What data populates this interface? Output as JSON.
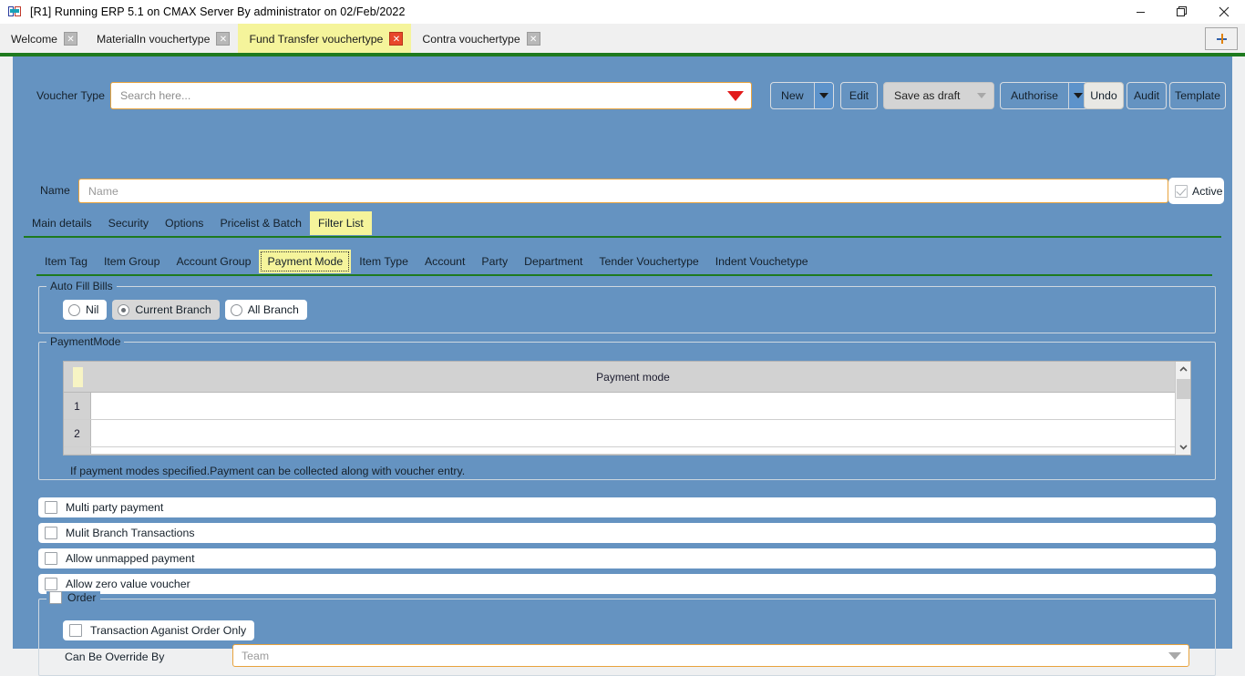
{
  "window": {
    "title": "[R1] Running ERP 5.1 on CMAX Server By administrator on 02/Feb/2022",
    "app_icon": "erp-app-icon",
    "minimize_icon": "minimize-icon",
    "restore_icon": "restore-icon",
    "close_icon": "close-icon"
  },
  "tabstrip": {
    "tabs": [
      {
        "label": "Welcome",
        "active": false
      },
      {
        "label": "MaterialIn vouchertype",
        "active": false
      },
      {
        "label": "Fund Transfer vouchertype",
        "active": true
      },
      {
        "label": "Contra vouchertype",
        "active": false
      }
    ],
    "new_tab_label": "+"
  },
  "form": {
    "voucher_type_label": "Voucher Type",
    "voucher_type_value": "",
    "voucher_type_placeholder": "Search here...",
    "name_label": "Name",
    "name_value": "",
    "name_placeholder": "Name",
    "active_label": "Active",
    "active_checked": true
  },
  "toolbar": {
    "new_label": "New",
    "edit_label": "Edit",
    "save_as_draft_label": "Save as draft",
    "authorise_label": "Authorise",
    "undo_label": "Undo",
    "audit_label": "Audit",
    "template_label": "Template"
  },
  "primary_tabs": [
    {
      "label": "Main details",
      "selected": false
    },
    {
      "label": "Security",
      "selected": false
    },
    {
      "label": "Options",
      "selected": false
    },
    {
      "label": "Pricelist & Batch",
      "selected": false
    },
    {
      "label": "Filter List",
      "selected": true
    }
  ],
  "secondary_tabs": [
    {
      "label": "Item Tag",
      "selected": false
    },
    {
      "label": "Item Group",
      "selected": false
    },
    {
      "label": "Account Group",
      "selected": false
    },
    {
      "label": "Payment Mode",
      "selected": true
    },
    {
      "label": "Item Type",
      "selected": false
    },
    {
      "label": "Account",
      "selected": false
    },
    {
      "label": "Party",
      "selected": false
    },
    {
      "label": "Department",
      "selected": false
    },
    {
      "label": "Tender Vouchertype",
      "selected": false
    },
    {
      "label": "Indent Vouchetype",
      "selected": false
    }
  ],
  "auto_fill_bills": {
    "legend": "Auto Fill Bills",
    "options": [
      {
        "label": "Nil",
        "selected": false
      },
      {
        "label": "Current Branch",
        "selected": true
      },
      {
        "label": "All Branch",
        "selected": false
      }
    ]
  },
  "payment_mode": {
    "legend": "PaymentMode",
    "column_header": "Payment mode",
    "rows": [
      {
        "no": "1",
        "payment_mode": ""
      },
      {
        "no": "2",
        "payment_mode": ""
      }
    ],
    "note": "If payment modes specified.Payment can be collected along with voucher entry.",
    "scroll_up_icon": "chevron-up-icon",
    "scroll_down_icon": "chevron-down-icon"
  },
  "checkboxes": [
    {
      "label": "Multi party payment",
      "checked": false
    },
    {
      "label": "Mulit Branch Transactions",
      "checked": false
    },
    {
      "label": "Allow unmapped payment",
      "checked": false
    },
    {
      "label": "Allow zero value voucher",
      "checked": false
    }
  ],
  "order": {
    "legend": "Order",
    "legend_checked": false,
    "transaction_against_order_label": "Transaction Aganist Order Only",
    "transaction_against_order_checked": false,
    "override_label": "Can Be Override By",
    "override_value": "",
    "override_placeholder": "Team"
  },
  "colors": {
    "panel_bg": "#6593c1",
    "accent_yellow": "#f5f49b",
    "field_border": "#e8a33d",
    "green_rule": "#1e7a1e",
    "dropdown_red": "#e21b1b"
  }
}
